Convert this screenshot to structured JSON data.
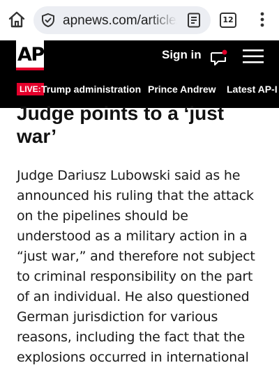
{
  "browser": {
    "url": "apnews.com/article/",
    "tab_count": "12"
  },
  "header": {
    "logo": "AP",
    "signin_label": "Sign in"
  },
  "nav": {
    "live_badge": "LIVE:",
    "items": [
      "Trump administration",
      "Prince Andrew",
      "Latest AP-I"
    ]
  },
  "article": {
    "subheading": "Judge points to a ‘just war’",
    "paragraph": "Judge Dariusz Lubowski said as he announced his ruling that the attack on the pipelines should be understood as a military action in a “just war,” and therefore not subject to criminal responsibility on the part of an individual. He also questioned German jurisdiction for various reasons, including the fact that the explosions occurred in international waters."
  },
  "colors": {
    "brand_red": "#e4002b",
    "header_bg": "#000000",
    "url_pill": "#eceef3"
  }
}
